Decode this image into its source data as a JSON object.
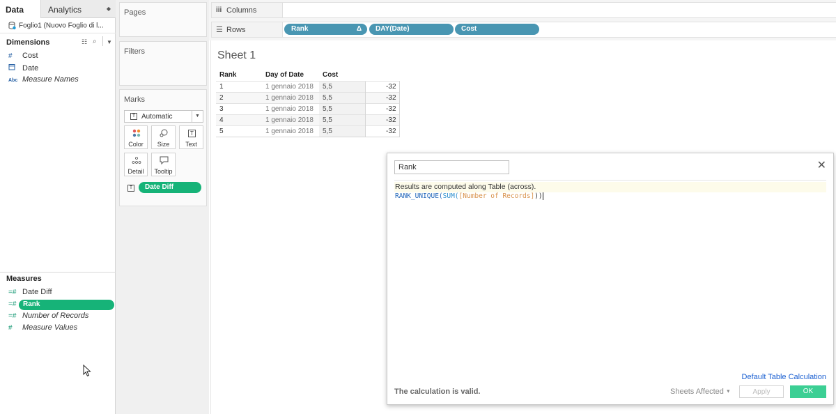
{
  "left_pane": {
    "tabs": [
      "Data",
      "Analytics"
    ],
    "data_source": "Foglio1 (Nuovo Foglio di l...",
    "dimensions_title": "Dimensions",
    "dimensions": [
      {
        "icon": "number-icon",
        "symbol": "#",
        "label": "Cost",
        "italic": false
      },
      {
        "icon": "calendar-icon",
        "symbol": "",
        "label": "Date",
        "italic": false
      },
      {
        "icon": "abc-icon",
        "symbol": "Abc",
        "label": "Measure Names",
        "italic": true
      }
    ],
    "measures_title": "Measures",
    "measures": [
      {
        "icon": "calc-number-icon",
        "symbol": "=#",
        "label": "Date Diff",
        "italic": false,
        "selected": false
      },
      {
        "icon": "calc-number-icon",
        "symbol": "=#",
        "label": "Rank",
        "italic": false,
        "selected": true
      },
      {
        "icon": "calc-number-icon",
        "symbol": "=#",
        "label": "Number of Records",
        "italic": true,
        "selected": false
      },
      {
        "icon": "number-icon",
        "symbol": "#",
        "label": "Measure Values",
        "italic": true,
        "selected": false
      }
    ]
  },
  "cards": {
    "pages": "Pages",
    "filters": "Filters",
    "marks": "Marks",
    "mark_type": "Automatic",
    "mark_buttons": [
      "Color",
      "Size",
      "Text",
      "Detail",
      "Tooltip"
    ],
    "mark_pill": "Date Diff"
  },
  "shelves": {
    "columns_label": "Columns",
    "rows_label": "Rows",
    "row_pills": [
      "Rank",
      "DAY(Date)",
      "Cost"
    ],
    "rank_delta": "Δ"
  },
  "sheet": {
    "title": "Sheet 1",
    "headers": [
      "Rank",
      "Day of Date",
      "Cost"
    ],
    "rows": [
      {
        "rank": "1",
        "date": "1 gennaio 2018",
        "cost": "5,5",
        "value": "-32"
      },
      {
        "rank": "2",
        "date": "1 gennaio 2018",
        "cost": "5,5",
        "value": "-32"
      },
      {
        "rank": "3",
        "date": "1 gennaio 2018",
        "cost": "5,5",
        "value": "-32"
      },
      {
        "rank": "4",
        "date": "1 gennaio 2018",
        "cost": "5,5",
        "value": "-32"
      },
      {
        "rank": "5",
        "date": "1 gennaio 2018",
        "cost": "5,5",
        "value": "-32"
      }
    ]
  },
  "dialog": {
    "name_value": "Rank",
    "info": "Results are computed along Table (across).",
    "formula_func": "RANK_UNIQUE(",
    "formula_sum": "SUM(",
    "formula_field": "[Number of Records]",
    "formula_close": "))",
    "default_calc_link": "Default Table Calculation",
    "status": "The calculation is valid.",
    "sheets_affected": "Sheets Affected",
    "apply": "Apply",
    "ok": "OK"
  },
  "colors": {
    "blue_pill": "#4996b2",
    "green_pill": "#16b378",
    "ok_button": "#3ccf94",
    "link": "#1a5fd1"
  }
}
